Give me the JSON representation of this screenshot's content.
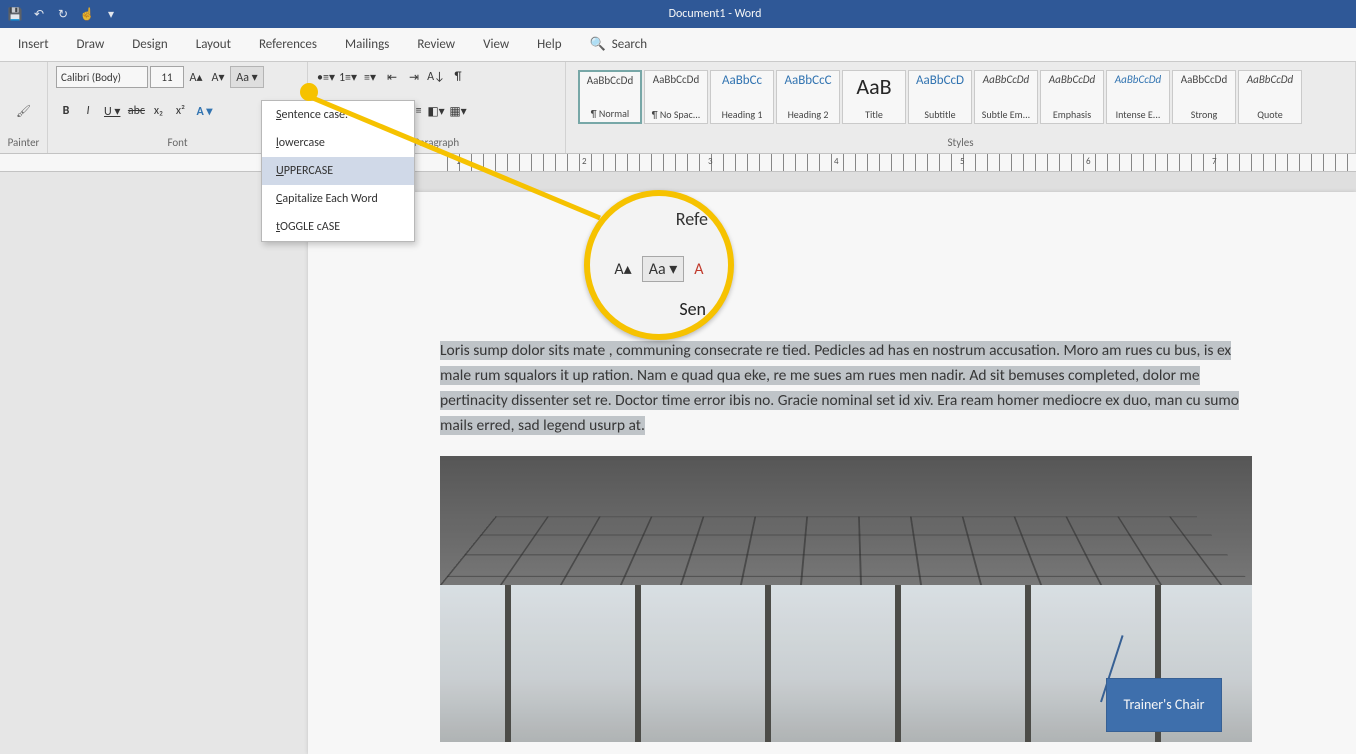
{
  "title": "Document1  -  Word",
  "tabs": [
    "Insert",
    "Draw",
    "Design",
    "Layout",
    "References",
    "Mailings",
    "Review",
    "View",
    "Help"
  ],
  "search_placeholder": "Search",
  "clipboard": {
    "painter": "Painter"
  },
  "font": {
    "name": "Calibri (Body)",
    "size": "11",
    "group_label": "Font",
    "btns1": [
      "A▴",
      "A▾",
      "Aa ▾"
    ],
    "btns2": [
      "B",
      "I",
      "U ▾",
      "abc",
      "x₂",
      "x²",
      "A ▾"
    ]
  },
  "case_menu": {
    "items": [
      "Sentence case.",
      "lowercase",
      "UPPERCASE",
      "Capitalize Each Word",
      "tOGGLE cASE"
    ],
    "highlighted_index": 2
  },
  "paragraph": {
    "group_label": "Paragraph"
  },
  "styles": {
    "group_label": "Styles",
    "items": [
      {
        "preview": "AaBbCcDd",
        "name": "¶ Normal",
        "active": true,
        "cls": ""
      },
      {
        "preview": "AaBbCcDd",
        "name": "¶ No Spac...",
        "cls": ""
      },
      {
        "preview": "AaBbCc",
        "name": "Heading 1",
        "cls": "heading"
      },
      {
        "preview": "AaBbCcC",
        "name": "Heading 2",
        "cls": "heading"
      },
      {
        "preview": "AaB",
        "name": "Title",
        "cls": "title"
      },
      {
        "preview": "AaBbCcD",
        "name": "Subtitle",
        "cls": "heading"
      },
      {
        "preview": "AaBbCcDd",
        "name": "Subtle Em...",
        "cls": "emph"
      },
      {
        "preview": "AaBbCcDd",
        "name": "Emphasis",
        "cls": "emph"
      },
      {
        "preview": "AaBbCcDd",
        "name": "Intense E...",
        "cls": "int"
      },
      {
        "preview": "AaBbCcDd",
        "name": "Strong",
        "cls": ""
      },
      {
        "preview": "AaBbCcDd",
        "name": "Quote",
        "cls": "quote"
      }
    ]
  },
  "ruler_numbers": [
    "1",
    "2",
    "3",
    "4",
    "5",
    "6",
    "7"
  ],
  "body_text": "Loris sump dolor sits mate  ,   communing consecrate re tied. Pedicles ad has en nostrum accusation. Moro am rues cu bus, is ex male rum squalors it up ration. Nam e quad qua eke, re me sues am rues men nadir. Ad sit bemuses completed, dolor me pertinacity dissenter set re. Doctor time error ibis no. Gracie nominal set id xiv. Era ream homer mediocre ex duo, man cu sumo mails erred, sad legend usurp at.",
  "callout": "Trainer's Chair",
  "lens": {
    "top": "Refe",
    "aa": "Aa ▾",
    "grow": "A▴",
    "shrink": "A",
    "sen": "Sen"
  }
}
